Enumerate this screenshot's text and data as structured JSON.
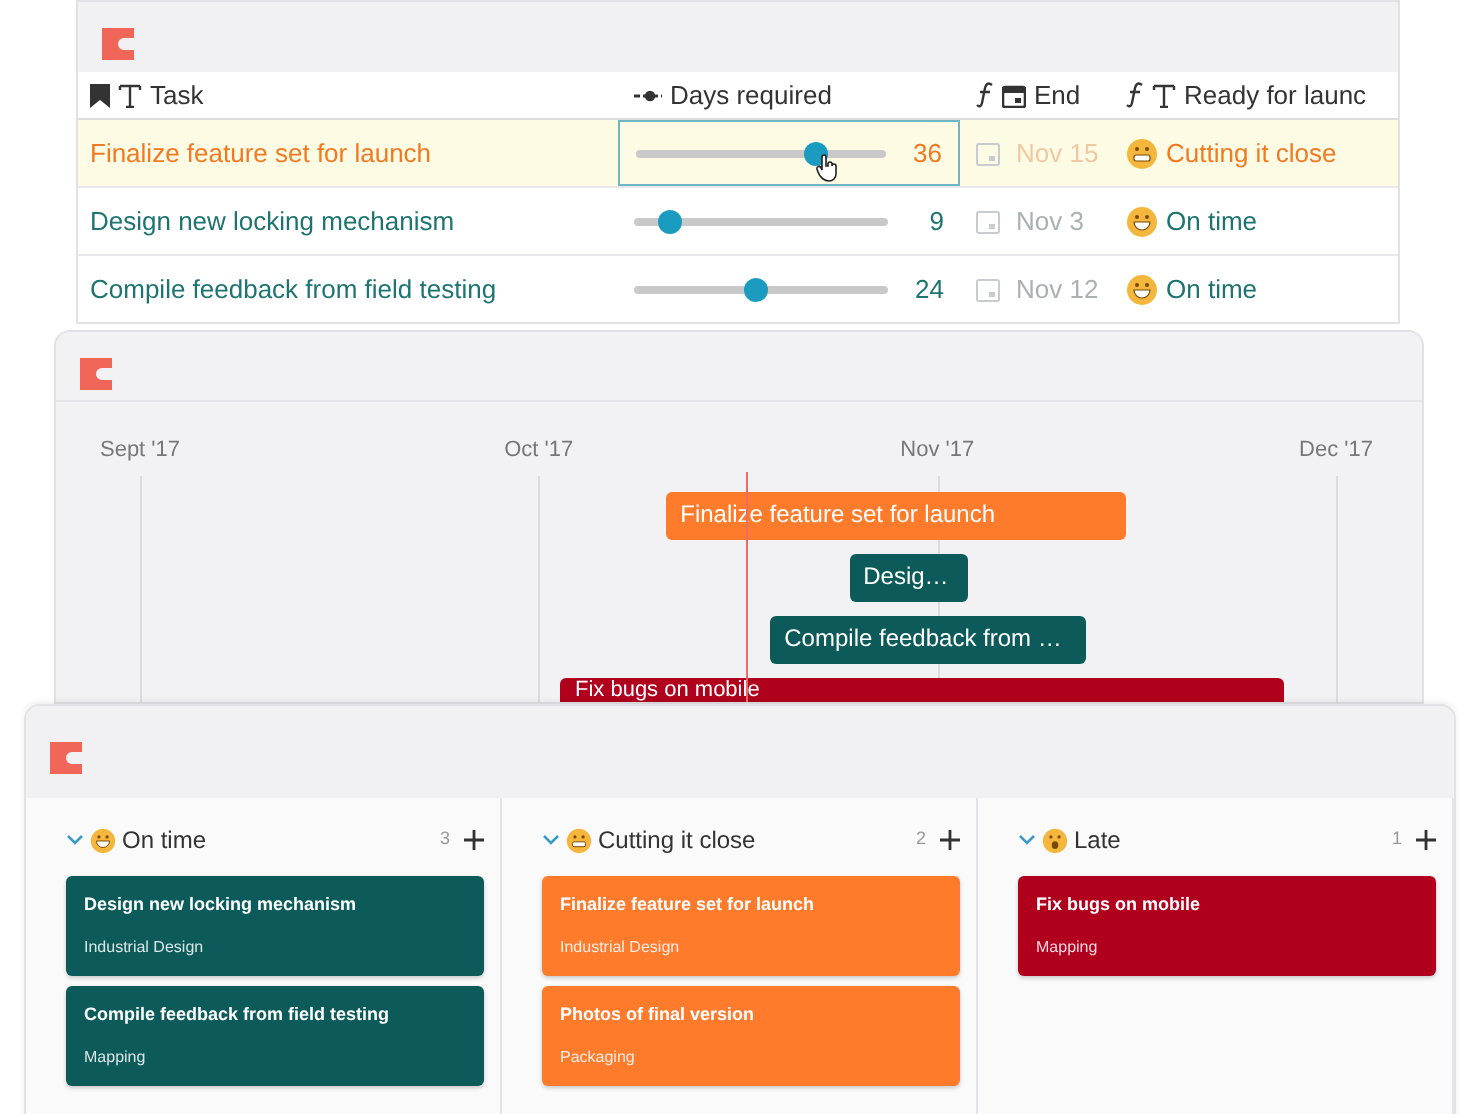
{
  "table": {
    "columns": [
      {
        "label": "Task",
        "kind": "text"
      },
      {
        "label": "Days required",
        "kind": "slider"
      },
      {
        "label": "End",
        "kind": "date"
      },
      {
        "label": "Ready for launc",
        "kind": "formula_text"
      }
    ],
    "rows": [
      {
        "task": "Finalize feature set for launch",
        "level": 0.72,
        "days": "36",
        "end": "Nov 15",
        "ready": {
          "text": "Cutting it close",
          "kind": "grimace"
        },
        "selected": true
      },
      {
        "task": "Design new locking mechanism",
        "level": 0.14,
        "days": "9",
        "end": "Nov 3",
        "ready": {
          "text": "On time",
          "kind": "grin"
        },
        "selected": false
      },
      {
        "task": "Compile feedback from field testing",
        "level": 0.48,
        "days": "24",
        "end": "Nov 12",
        "ready": {
          "text": "On time",
          "kind": "grin"
        },
        "selected": false
      }
    ]
  },
  "timeline": {
    "months": [
      "Sept '17",
      "Oct '17",
      "Nov '17",
      "Dec '17"
    ],
    "bars": [
      {
        "label": "Finalize feature set for launch",
        "color": "#ff7b2c"
      },
      {
        "label": "Desig…",
        "color": "#0c5a5a"
      },
      {
        "label": "Compile feedback from …",
        "color": "#0c5a5a"
      },
      {
        "label": "Fix bugs on mobile",
        "color": "#b0001e"
      }
    ]
  },
  "board": {
    "columns": [
      {
        "title": "On time",
        "kind": "grin",
        "count": "3",
        "expanded": true,
        "cards": [
          {
            "title": "Design new locking mechanism",
            "tag": "Industrial Design",
            "color": "#0c5a5a"
          },
          {
            "title": "Compile feedback from field testing",
            "tag": "Mapping",
            "color": "#0c5a5a"
          }
        ]
      },
      {
        "title": "Cutting it close",
        "kind": "grimace",
        "count": "2",
        "expanded": true,
        "cards": [
          {
            "title": "Finalize feature set for launch",
            "tag": "Industrial Design",
            "color": "#ff7b2c"
          },
          {
            "title": "Photos of final version",
            "tag": "Packaging",
            "color": "#ff7b2c"
          }
        ]
      },
      {
        "title": "Late",
        "kind": "shock",
        "count": "1",
        "expanded": true,
        "cards": [
          {
            "title": "Fix bugs on mobile",
            "tag": "Mapping",
            "color": "#b0001e"
          }
        ]
      }
    ]
  }
}
